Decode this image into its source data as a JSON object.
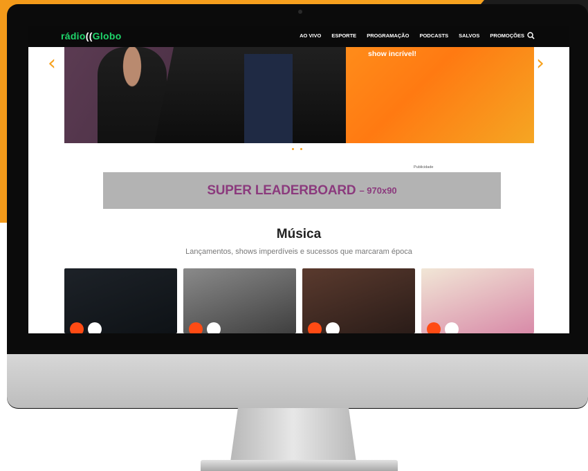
{
  "brand": {
    "logo_pre": "rádio",
    "logo_paren": "((",
    "logo_post": "Globo",
    "accent": "#1fd66b",
    "orange": "#f7a21f"
  },
  "nav": {
    "items": [
      "AO VIVO",
      "ESPORTE",
      "PROGRAMAÇÃO",
      "PODCASTS",
      "SALVOS",
      "PROMOÇÕES"
    ],
    "search_icon": "search-icon"
  },
  "hero": {
    "caption": "show incrível!",
    "prev_icon": "chevron-left-icon",
    "next_icon": "chevron-right-icon"
  },
  "ad": {
    "label": "Publicidade",
    "title": "SUPER LEADERBOARD",
    "size": "– 970x90",
    "text_color": "#8b3a7d"
  },
  "section": {
    "title": "Música",
    "subtitle": "Lançamentos, shows imperdíveis e sucessos que marcaram época"
  }
}
